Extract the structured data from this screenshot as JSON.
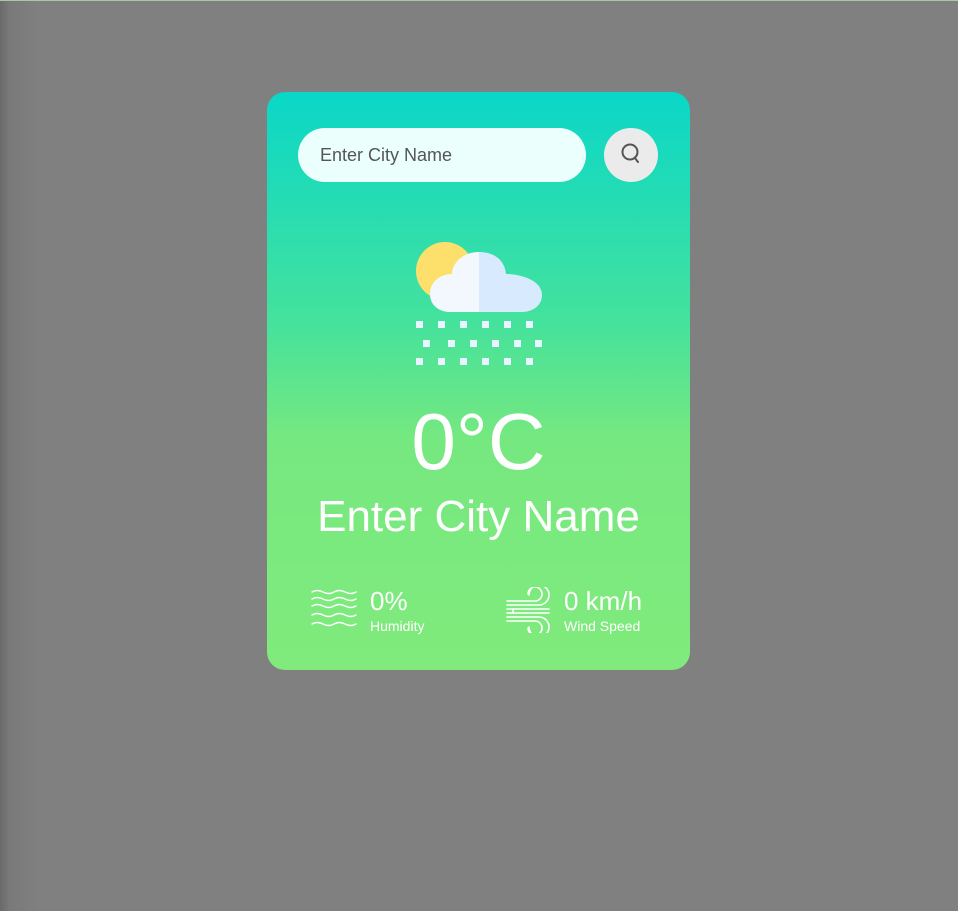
{
  "search": {
    "placeholder": "Enter City Name"
  },
  "weather": {
    "icon": "cloud-snow-sun-icon",
    "temperature": "0°C",
    "city": "Enter City Name"
  },
  "details": {
    "humidity": {
      "value": "0%",
      "label": "Humidity",
      "icon": "humidity-waves-icon"
    },
    "wind": {
      "value": "0 km/h",
      "label": "Wind Speed",
      "icon": "wind-icon"
    }
  },
  "colors": {
    "background": "#808080",
    "card_gradient_top": "#0ad7c8",
    "card_gradient_bottom": "#80eb7c",
    "input_bg": "#ebfffc",
    "button_bg": "#ebebeb"
  }
}
